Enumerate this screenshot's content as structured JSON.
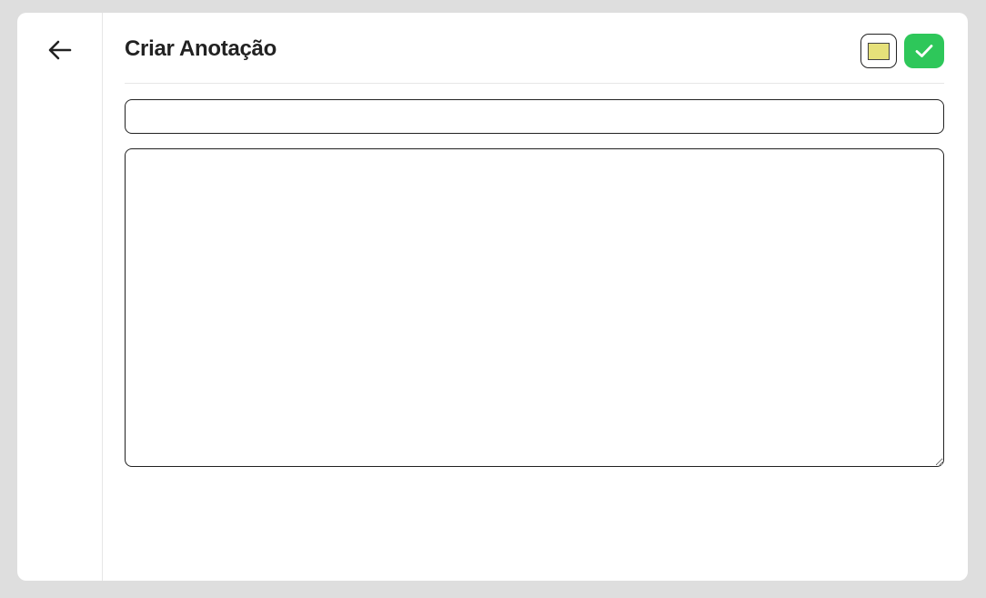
{
  "header": {
    "title": "Criar Anotação"
  },
  "icons": {
    "back": "arrow-left-icon",
    "confirm": "check-icon"
  },
  "colors": {
    "background": "#dedede",
    "card": "#ffffff",
    "selected_note_color": "#e6e17a",
    "confirm_button": "#2ec75a",
    "text": "#222222"
  },
  "form": {
    "title_value": "",
    "title_placeholder": "",
    "content_value": "",
    "content_placeholder": ""
  }
}
